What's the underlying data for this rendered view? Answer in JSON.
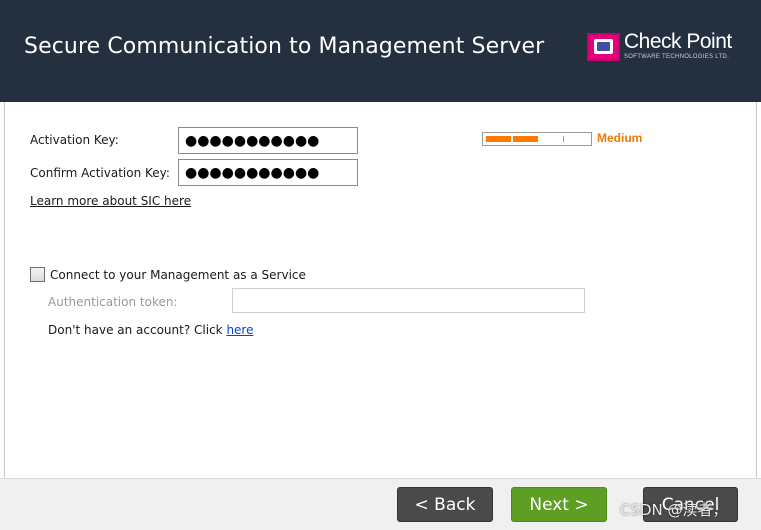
{
  "header": {
    "title": "Secure Communication to Management Server",
    "logo_text": "Check Point",
    "logo_subtext": "SOFTWARE TECHNOLOGIES LTD."
  },
  "form": {
    "activation_key_label": "Activation Key:",
    "activation_key_value": "●●●●●●●●●●●",
    "confirm_key_label": "Confirm Activation Key:",
    "confirm_key_value": "●●●●●●●●●●●",
    "learn_more_link": "Learn more about SIC here",
    "strength": {
      "label": "Medium",
      "level_fraction": 0.5,
      "color": "#f07800"
    }
  },
  "service": {
    "checkbox_label": "Connect to your Management as a Service",
    "checked": false,
    "auth_token_label": "Authentication token:",
    "auth_token_value": "",
    "no_account_text": "Don't have an account? Click ",
    "here_link": "here"
  },
  "footer": {
    "back_label": "< Back",
    "next_label": "Next >",
    "cancel_label": "Cancel"
  },
  "watermark": "CSDN @渎者，",
  "colors": {
    "header_bg": "#243040",
    "next_button": "#5e9e25",
    "back_button": "#4a4a4a",
    "strength_orange": "#ff7a00"
  }
}
